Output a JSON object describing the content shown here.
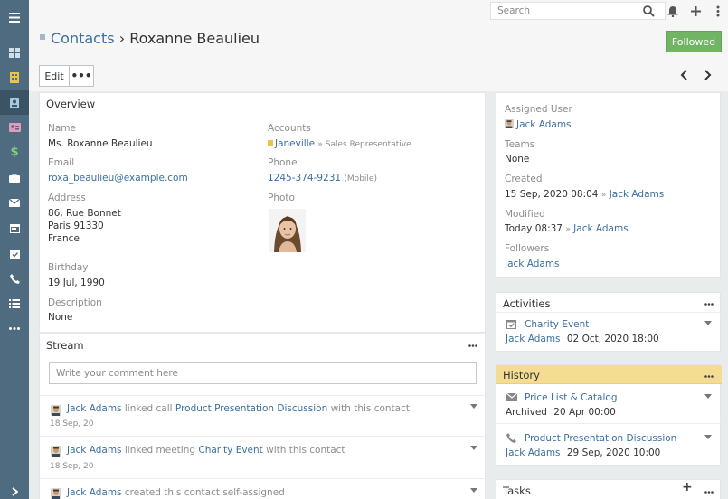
{
  "search": {
    "placeholder": "Search"
  },
  "breadcrumb": {
    "module": "Contacts",
    "separator": "›",
    "record": "Roxanne Beaulieu"
  },
  "followed_label": "Followed",
  "edit_label": "Edit",
  "more_label": "•••",
  "overview": {
    "title": "Overview",
    "name_label": "Name",
    "name_value": "Ms. Roxanne Beaulieu",
    "accounts_label": "Accounts",
    "account_name": "Janeville",
    "account_role": "» Sales Representative",
    "email_label": "Email",
    "email_value": "roxa_beaulieu@example.com",
    "phone_label": "Phone",
    "phone_value": "1245-374-9231",
    "phone_type": "(Mobile)",
    "address_label": "Address",
    "address_line1": "86, Rue Bonnet",
    "address_line2": "Paris 91330",
    "address_line3": "France",
    "photo_label": "Photo",
    "birthday_label": "Birthday",
    "birthday_value": "19 Jul, 1990",
    "description_label": "Description",
    "description_value": "None"
  },
  "stream": {
    "title": "Stream",
    "placeholder": "Write your comment here",
    "entries": [
      {
        "user": "Jack Adams",
        "action": "linked call",
        "target": "Product Presentation Discussion",
        "suffix": "with this contact",
        "date": "18 Sep, 20"
      },
      {
        "user": "Jack Adams",
        "action": "linked meeting",
        "target": "Charity Event",
        "suffix": "with this contact",
        "date": "18 Sep, 20"
      },
      {
        "user": "Jack Adams",
        "action": "created this contact self-assigned",
        "target": "",
        "suffix": "",
        "date": ""
      }
    ]
  },
  "side": {
    "assigned_label": "Assigned User",
    "assigned_value": "Jack Adams",
    "teams_label": "Teams",
    "teams_value": "None",
    "created_label": "Created",
    "created_date": "15 Sep, 2020 08:04",
    "created_by": "Jack Adams",
    "modified_label": "Modified",
    "modified_date": "Today 08:37",
    "modified_by": "Jack Adams",
    "followers_label": "Followers",
    "followers_value": "Jack Adams",
    "by_sep": "»"
  },
  "activities": {
    "title": "Activities",
    "item_name": "Charity Event",
    "item_user": "Jack Adams",
    "item_date": "02 Oct, 2020 18:00"
  },
  "history": {
    "title": "History",
    "item1_name": "Price List & Catalog",
    "item1_status": "Archived",
    "item1_date": "20 Apr 00:00",
    "item2_name": "Product Presentation Discussion",
    "item2_user": "Jack Adams",
    "item2_date": "29 Sep, 2020 10:00"
  },
  "tasks": {
    "title": "Tasks",
    "add": "+"
  },
  "colors": {
    "sidebar": "#4e6b80",
    "accent_link": "#3a6fa0",
    "followed": "#71b564",
    "history_header": "#f4dc93"
  },
  "icons": [
    "menu-icon",
    "dashboard-icon",
    "building-icon",
    "contact-icon",
    "lead-icon",
    "dollar-icon",
    "briefcase-icon",
    "envelope-icon",
    "calendar-icon",
    "calendar-check-icon",
    "phone-icon",
    "list-icon",
    "more-icon",
    "expand-icon",
    "search-icon",
    "bell-icon",
    "plus-icon",
    "kebab-icon"
  ]
}
